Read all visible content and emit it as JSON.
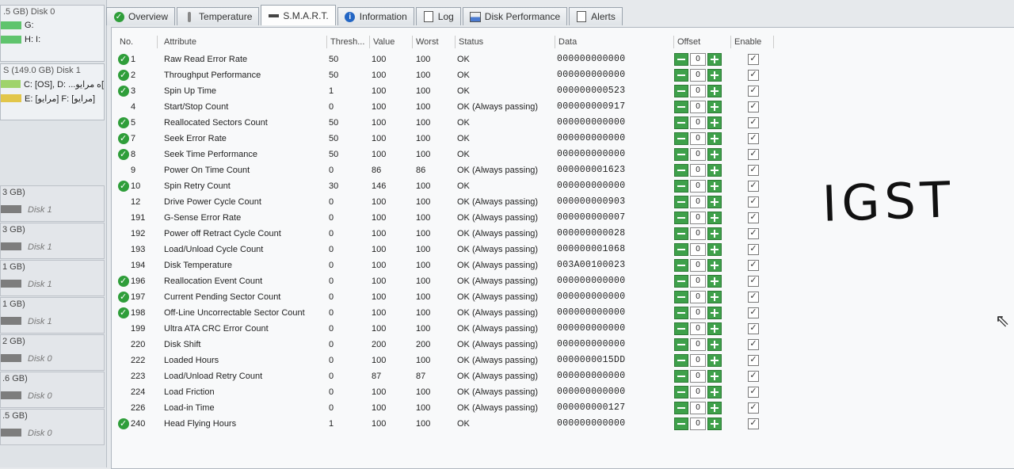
{
  "left": {
    "top_header": ".5 GB) Disk 0",
    "disk0_vols": [
      {
        "label": "G:",
        "color": "#5fc46d"
      },
      {
        "label": "H: I:",
        "color": "#5fc46d"
      }
    ],
    "disk1_header": "S (149.0 GB) Disk 1",
    "disk1_vols": [
      {
        "label": "C: [OS], D: ...ه مرايو[",
        "color": "#9fd36b"
      },
      {
        "label": "E: [مرايو] F: [مرايو]",
        "color": "#e2c64a"
      }
    ],
    "rows": [
      {
        "size": "3 GB)",
        "label": "Disk 1"
      },
      {
        "size": "3 GB)",
        "label": "Disk 1"
      },
      {
        "size": "1 GB)",
        "label": "Disk 1"
      },
      {
        "size": "1 GB)",
        "label": "Disk 1"
      },
      {
        "size": "2 GB)",
        "label": "Disk 0"
      },
      {
        "size": ".6 GB)",
        "label": "Disk 0"
      },
      {
        "size": ".5 GB)",
        "label": "Disk 0"
      }
    ]
  },
  "tabs": [
    {
      "label": "Overview",
      "icon": "check-icon",
      "active": false
    },
    {
      "label": "Temperature",
      "icon": "thermometer-icon",
      "active": false
    },
    {
      "label": "S.M.A.R.T.",
      "icon": "drive-icon",
      "active": true
    },
    {
      "label": "Information",
      "icon": "info-icon",
      "active": false
    },
    {
      "label": "Log",
      "icon": "log-icon",
      "active": false
    },
    {
      "label": "Disk Performance",
      "icon": "chart-icon",
      "active": false
    },
    {
      "label": "Alerts",
      "icon": "alerts-icon",
      "active": false
    }
  ],
  "table": {
    "headers": {
      "no": "No.",
      "attribute": "Attribute",
      "thresh": "Thresh...",
      "value": "Value",
      "worst": "Worst",
      "status": "Status",
      "data": "Data",
      "offset": "Offset",
      "enable": "Enable"
    },
    "rows": [
      {
        "no": "1",
        "attr": "Raw Read Error Rate",
        "thresh": "50",
        "value": "100",
        "worst": "100",
        "status": "OK",
        "data": "000000000000",
        "icon": true
      },
      {
        "no": "2",
        "attr": "Throughput Performance",
        "thresh": "50",
        "value": "100",
        "worst": "100",
        "status": "OK",
        "data": "000000000000",
        "icon": true
      },
      {
        "no": "3",
        "attr": "Spin Up Time",
        "thresh": "1",
        "value": "100",
        "worst": "100",
        "status": "OK",
        "data": "000000000523",
        "icon": true
      },
      {
        "no": "4",
        "attr": "Start/Stop Count",
        "thresh": "0",
        "value": "100",
        "worst": "100",
        "status": "OK (Always passing)",
        "data": "000000000917",
        "icon": false
      },
      {
        "no": "5",
        "attr": "Reallocated Sectors Count",
        "thresh": "50",
        "value": "100",
        "worst": "100",
        "status": "OK",
        "data": "000000000000",
        "icon": true
      },
      {
        "no": "7",
        "attr": "Seek Error Rate",
        "thresh": "50",
        "value": "100",
        "worst": "100",
        "status": "OK",
        "data": "000000000000",
        "icon": true
      },
      {
        "no": "8",
        "attr": "Seek Time Performance",
        "thresh": "50",
        "value": "100",
        "worst": "100",
        "status": "OK",
        "data": "000000000000",
        "icon": true
      },
      {
        "no": "9",
        "attr": "Power On Time Count",
        "thresh": "0",
        "value": "86",
        "worst": "86",
        "status": "OK (Always passing)",
        "data": "000000001623",
        "icon": false
      },
      {
        "no": "10",
        "attr": "Spin Retry Count",
        "thresh": "30",
        "value": "146",
        "worst": "100",
        "status": "OK",
        "data": "000000000000",
        "icon": true
      },
      {
        "no": "12",
        "attr": "Drive Power Cycle Count",
        "thresh": "0",
        "value": "100",
        "worst": "100",
        "status": "OK (Always passing)",
        "data": "000000000903",
        "icon": false
      },
      {
        "no": "191",
        "attr": "G-Sense Error Rate",
        "thresh": "0",
        "value": "100",
        "worst": "100",
        "status": "OK (Always passing)",
        "data": "000000000007",
        "icon": false
      },
      {
        "no": "192",
        "attr": "Power off Retract Cycle Count",
        "thresh": "0",
        "value": "100",
        "worst": "100",
        "status": "OK (Always passing)",
        "data": "000000000028",
        "icon": false
      },
      {
        "no": "193",
        "attr": "Load/Unload Cycle Count",
        "thresh": "0",
        "value": "100",
        "worst": "100",
        "status": "OK (Always passing)",
        "data": "000000001068",
        "icon": false
      },
      {
        "no": "194",
        "attr": "Disk Temperature",
        "thresh": "0",
        "value": "100",
        "worst": "100",
        "status": "OK (Always passing)",
        "data": "003A00100023",
        "icon": false
      },
      {
        "no": "196",
        "attr": "Reallocation Event Count",
        "thresh": "0",
        "value": "100",
        "worst": "100",
        "status": "OK (Always passing)",
        "data": "000000000000",
        "icon": true
      },
      {
        "no": "197",
        "attr": "Current Pending Sector Count",
        "thresh": "0",
        "value": "100",
        "worst": "100",
        "status": "OK (Always passing)",
        "data": "000000000000",
        "icon": true
      },
      {
        "no": "198",
        "attr": "Off-Line Uncorrectable Sector Count",
        "thresh": "0",
        "value": "100",
        "worst": "100",
        "status": "OK (Always passing)",
        "data": "000000000000",
        "icon": true
      },
      {
        "no": "199",
        "attr": "Ultra ATA CRC Error Count",
        "thresh": "0",
        "value": "100",
        "worst": "100",
        "status": "OK (Always passing)",
        "data": "000000000000",
        "icon": false
      },
      {
        "no": "220",
        "attr": "Disk Shift",
        "thresh": "0",
        "value": "200",
        "worst": "200",
        "status": "OK (Always passing)",
        "data": "000000000000",
        "icon": false
      },
      {
        "no": "222",
        "attr": "Loaded Hours",
        "thresh": "0",
        "value": "100",
        "worst": "100",
        "status": "OK (Always passing)",
        "data": "0000000015DD",
        "icon": false
      },
      {
        "no": "223",
        "attr": "Load/Unload Retry Count",
        "thresh": "0",
        "value": "87",
        "worst": "87",
        "status": "OK (Always passing)",
        "data": "000000000000",
        "icon": false
      },
      {
        "no": "224",
        "attr": "Load Friction",
        "thresh": "0",
        "value": "100",
        "worst": "100",
        "status": "OK (Always passing)",
        "data": "000000000000",
        "icon": false
      },
      {
        "no": "226",
        "attr": "Load-in Time",
        "thresh": "0",
        "value": "100",
        "worst": "100",
        "status": "OK (Always passing)",
        "data": "000000000127",
        "icon": false
      },
      {
        "no": "240",
        "attr": "Head Flying Hours",
        "thresh": "1",
        "value": "100",
        "worst": "100",
        "status": "OK",
        "data": "000000000000",
        "icon": true
      }
    ],
    "offset_value": "0"
  },
  "handwritten": "IGST"
}
